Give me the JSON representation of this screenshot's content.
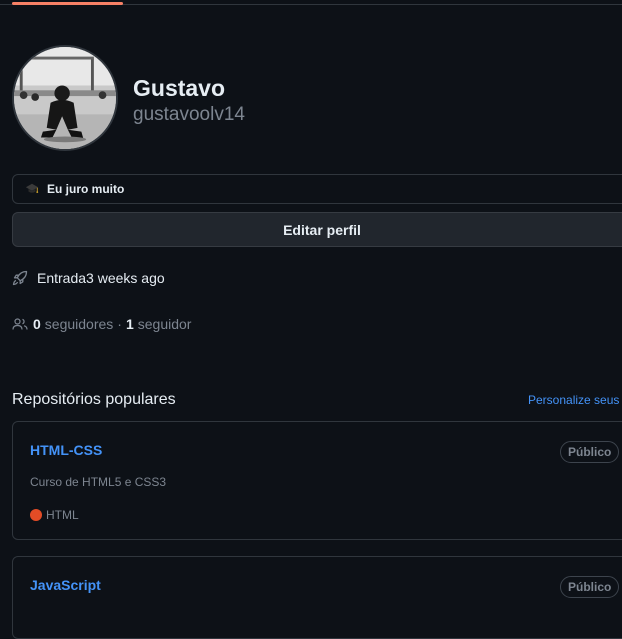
{
  "profile": {
    "name": "Gustavo",
    "login": "gustavoolv14",
    "status_text": "Eu juro muito",
    "status_icon": "graduation-cap-icon",
    "edit_button": "Editar perfil",
    "joined": "Entrada3 weeks ago",
    "followers_count": "0",
    "followers_label": "seguidores",
    "following_count": "1",
    "following_label": "seguidor"
  },
  "popular": {
    "title": "Repositórios populares",
    "customize_link": "Personalize seus p"
  },
  "repos": [
    {
      "name": "HTML-CSS",
      "visibility": "Público",
      "description": "Curso de HTML5 e CSS3",
      "language": "HTML",
      "language_color": "#e34c26"
    },
    {
      "name": "JavaScript",
      "visibility": "Público"
    }
  ],
  "colors": {
    "background": "#0d1117",
    "border": "#30363d",
    "link": "#4493f8",
    "muted": "#7d8590",
    "tab_accent": "#f78166"
  }
}
